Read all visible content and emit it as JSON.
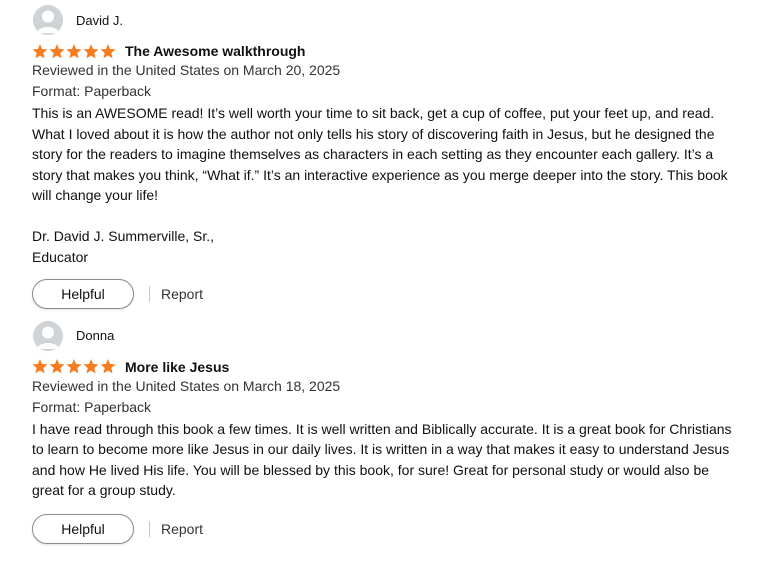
{
  "colors": {
    "star": "#f57c1f",
    "avatar_bg": "#cfd3d5",
    "text": "#0f1111"
  },
  "reviews": [
    {
      "reviewer": "David J.",
      "rating": 5,
      "title": "The Awesome walkthrough",
      "reviewed_line": "Reviewed in the United States on March 20, 2025",
      "format_line": "Format: Paperback",
      "body": "This is an AWESOME read! It’s well worth your time to sit back, get a cup of coffee, put your feet up, and read. What I loved about it is how the author not only tells his story of discovering faith in Jesus, but he designed the story for the readers to imagine themselves as characters in each setting as they encounter each gallery. It’s a story that makes you think, “What if.” It’s an interactive experience as you merge deeper into the story. This book will change your life!",
      "signature_line1": "Dr. David J. Summerville, Sr.,",
      "signature_line2": "Educator",
      "helpful_label": "Helpful",
      "report_label": "Report"
    },
    {
      "reviewer": "Donna",
      "rating": 5,
      "title": "More like Jesus",
      "reviewed_line": "Reviewed in the United States on March 18, 2025",
      "format_line": "Format: Paperback",
      "body": "I have read through this book a few times. It is well written and Biblically accurate. It is a great book for Christians to learn to become more like Jesus in our daily lives. It is written in a way that makes it easy to understand Jesus and how He lived His life. You will be blessed by this book, for sure! Great for personal study or would also be great for a group study.",
      "helpful_label": "Helpful",
      "report_label": "Report"
    }
  ]
}
